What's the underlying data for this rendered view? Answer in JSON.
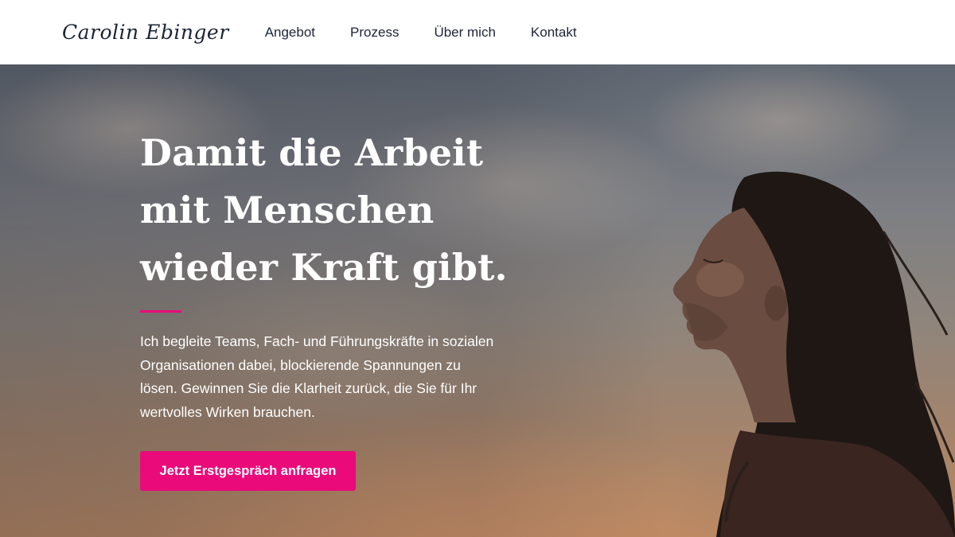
{
  "header": {
    "logo": "Carolin Ebinger",
    "nav": [
      "Angebot",
      "Prozess",
      "Über mich",
      "Kontakt"
    ]
  },
  "hero": {
    "title_lines": [
      "Damit die Arbeit",
      "mit Menschen",
      "wieder Kraft gibt."
    ],
    "text_lines": [
      "Ich begleite Teams, Fach- und Führungskräfte in sozialen",
      "Organisationen dabei, blockierende Spannungen zu",
      "lösen. Gewinnen Sie die Klarheit zurück, die Sie für Ihr",
      "wertvolles Wirken brauchen."
    ],
    "cta_label": "Jetzt Erstgespräch anfragen"
  },
  "colors": {
    "accent": "#ea0a7a",
    "text_dark": "#1b2437",
    "header_bg": "#ffffff"
  }
}
